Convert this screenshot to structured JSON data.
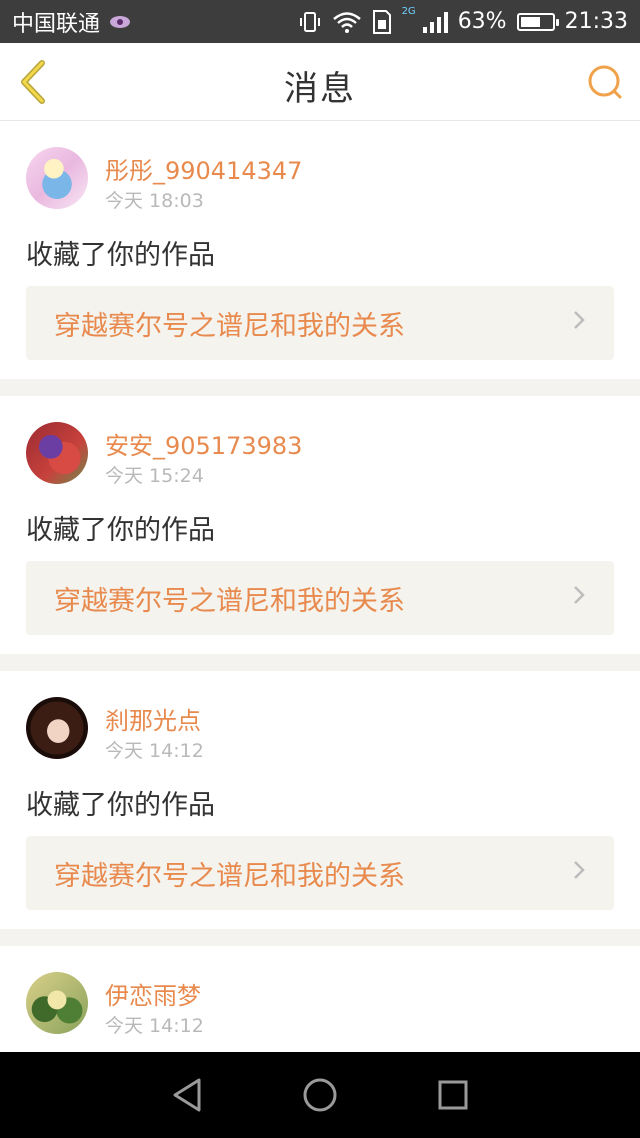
{
  "status_bar": {
    "carrier": "中国联通",
    "network_badge": "2G",
    "battery_percent": "63%",
    "battery_level": 0.63,
    "time": "21:33"
  },
  "header": {
    "title": "消息",
    "back_icon": "chevron-left-icon",
    "search_icon": "search-icon",
    "accent_color": "#f0a24a"
  },
  "messages": [
    {
      "user": "彤彤_990414347",
      "time": "今天 18:03",
      "action": "收藏了你的作品",
      "work_title": "穿越赛尔号之谱尼和我的关系"
    },
    {
      "user": "安安_905173983",
      "time": "今天 15:24",
      "action": "收藏了你的作品",
      "work_title": "穿越赛尔号之谱尼和我的关系"
    },
    {
      "user": "刹那光点",
      "time": "今天 14:12",
      "action": "收藏了你的作品",
      "work_title": "穿越赛尔号之谱尼和我的关系"
    },
    {
      "user": "伊恋雨梦",
      "time": "今天 14:12"
    }
  ],
  "colors": {
    "username": "#e88a4e",
    "work_title": "#e88a4e",
    "timestamp": "#b9b9b9",
    "background": "#f4f3ef"
  },
  "nav_bar": {
    "back": "triangle-back-icon",
    "home": "circle-home-icon",
    "recents": "square-recents-icon"
  }
}
